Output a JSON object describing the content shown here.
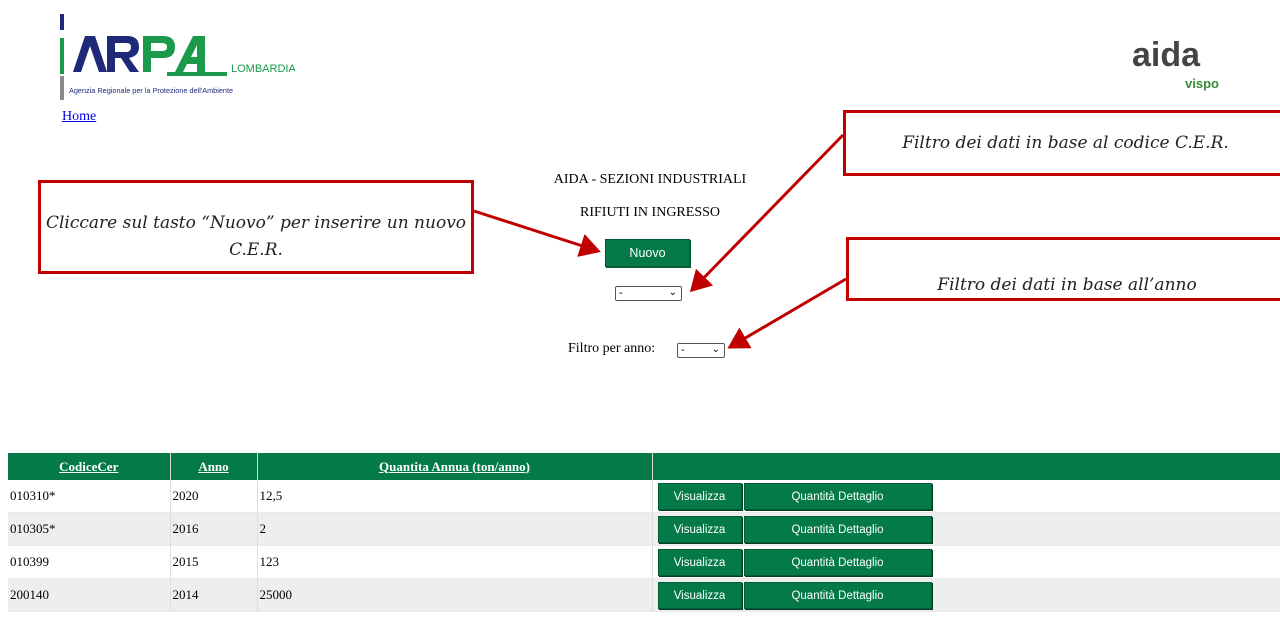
{
  "header": {
    "arpa_logo": {
      "name": "LOMBARDIA",
      "subtitle": "Agenzia Regionale per la Protezione dell'Ambiente"
    },
    "home_link": "Home",
    "aida_logo": {
      "main": "aida",
      "sub": "vispo"
    }
  },
  "main": {
    "title": "AIDA - SEZIONI INDUSTRIALI",
    "subtitle": "RIFIUTI IN INGRESSO",
    "nuovo_label": "Nuovo",
    "cer_filter_value": "-",
    "year_filter_label": "Filtro per anno:",
    "year_filter_value": "-"
  },
  "callouts": {
    "nuovo": "Cliccare sul tasto “Nuovo” per inserire un nuovo C.E.R.",
    "cer": "Filtro dei dati in base al codice C.E.R.",
    "anno": "Filtro dei dati in base all’anno"
  },
  "table": {
    "headers": [
      "CodiceCer",
      "Anno",
      "Quantita Annua (ton/anno)",
      ""
    ],
    "action_labels": {
      "view": "Visualizza",
      "detail": "Quantità Dettaglio"
    },
    "rows": [
      {
        "codice": "010310*",
        "anno": "2020",
        "quantita": "12,5"
      },
      {
        "codice": "010305*",
        "anno": "2016",
        "quantita": "2"
      },
      {
        "codice": "010399",
        "anno": "2015",
        "quantita": "123"
      },
      {
        "codice": "200140",
        "anno": "2014",
        "quantita": "25000"
      }
    ]
  },
  "colors": {
    "accent": "#047a48",
    "callout_border": "#c00000",
    "arpa_blue": "#1e2a78",
    "arpa_green": "#1a9a4a"
  }
}
